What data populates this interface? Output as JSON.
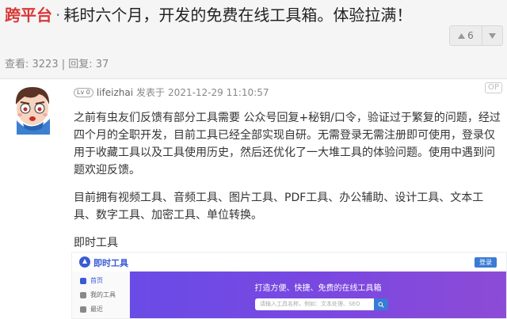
{
  "topic": {
    "node_tag": "跨平台",
    "separator": "·",
    "title": "耗时六个月，开发的免费在线工具箱。体验拉满！",
    "votes": {
      "up_count": "6"
    },
    "stats": "查看: 3223 | 回复: 37"
  },
  "post": {
    "level_badge": "Lv 0",
    "author": "lifeizhai",
    "posted_label": "发表于",
    "timestamp": "2021-12-29 11:10:57",
    "op_badge": "OP",
    "paragraphs": [
      "之前有虫友们反馈有部分工具需要 公众号回复+秘钥/口令，验证过于繁复的问题，经过四个月的全职开发，目前工具已经全部实现自研。无需登录无需注册即可使用，登录仅用于收藏工具以及工具使用历史，然后还优化了一大堆工具的体验问题。使用中遇到问题欢迎反馈。",
      "目前拥有视频工具、音频工具、图片工具、PDF工具、办公辅助、设计工具、文本工具、数字工具、加密工具、单位转换。",
      "即时工具"
    ]
  },
  "embed": {
    "site_name": "即时工具",
    "login_label": "登录",
    "sidebar_items": [
      "首页",
      "我的工具",
      "最近"
    ],
    "banner_title": "打造方便、快捷、免费的在线工具箱",
    "search_placeholder": "请输入工具名称，例如：文本处理、SEO",
    "colors": {
      "banner_start": "#6a4be6",
      "banner_end": "#8d4bd6",
      "brand_blue": "#3a5bd6",
      "node_red": "#d93838"
    }
  }
}
